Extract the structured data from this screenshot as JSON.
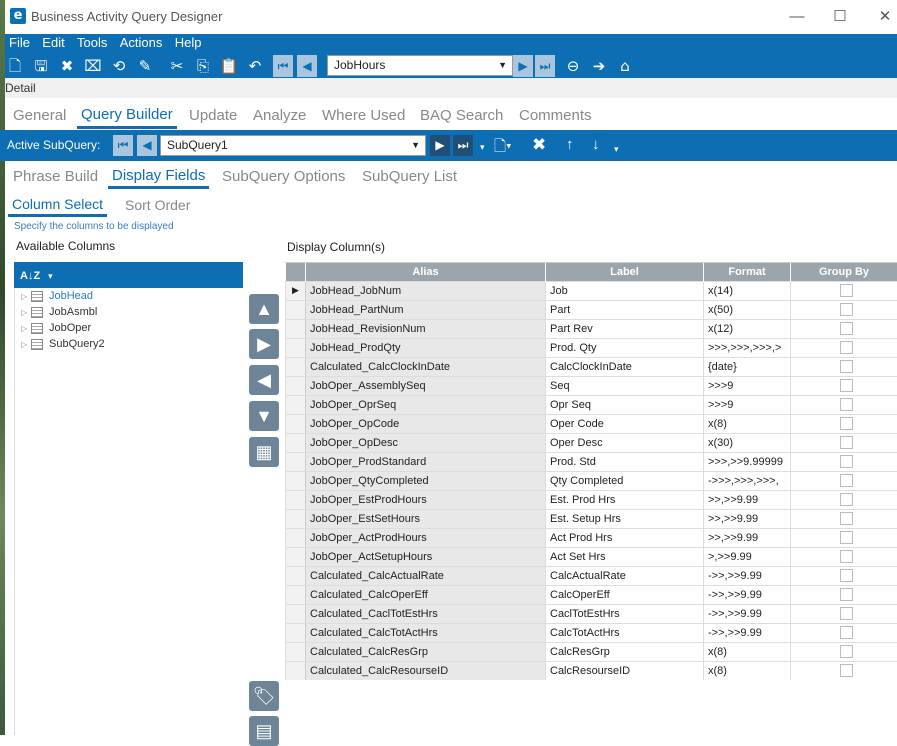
{
  "app": {
    "title": "Business Activity Query Designer",
    "logo_letter": "e",
    "min_glyph": "—",
    "max_glyph": "☐",
    "close_glyph": "✕"
  },
  "menu": [
    "File",
    "Edit",
    "Tools",
    "Actions",
    "Help"
  ],
  "toolbar": {
    "query_value": "JobHours",
    "icons": [
      "new-icon",
      "save-icon",
      "delete-icon",
      "clear-icon",
      "refresh-icon",
      "brush-icon",
      "cut-icon",
      "copy-icon",
      "paste-icon",
      "undo-icon",
      "first-icon",
      "prev-icon",
      "next-icon",
      "last-icon",
      "back-icon",
      "forward-icon",
      "home-icon"
    ]
  },
  "detail_label": "Detail",
  "main_tabs": [
    "General",
    "Query Builder",
    "Update",
    "Analyze",
    "Where Used",
    "BAQ Search",
    "Comments"
  ],
  "active_main_tab": "Query Builder",
  "subquery": {
    "label": "Active SubQuery:",
    "value": "SubQuery1"
  },
  "sub_tabs": [
    "Phrase Build",
    "Display Fields",
    "SubQuery Options",
    "SubQuery List"
  ],
  "active_sub_tab": "Display Fields",
  "inner_tabs": [
    "Column Select",
    "Sort Order"
  ],
  "active_inner_tab": "Column Select",
  "hint": "Specify the columns to be displayed",
  "available_columns_label": "Available Columns",
  "display_columns_label": "Display Column(s)",
  "tree_header_glyph": "A↓Z",
  "tree_items": [
    "JobHead",
    "JobAsmbl",
    "JobOper",
    "SubQuery2"
  ],
  "grid": {
    "headers": [
      "Alias",
      "Label",
      "Format",
      "Group By"
    ],
    "rows": [
      {
        "alias": "JobHead_JobNum",
        "label": "Job",
        "format": "x(14)"
      },
      {
        "alias": "JobHead_PartNum",
        "label": "Part",
        "format": "x(50)"
      },
      {
        "alias": "JobHead_RevisionNum",
        "label": "Part Rev",
        "format": "x(12)"
      },
      {
        "alias": "JobHead_ProdQty",
        "label": "Prod. Qty",
        "format": ">>>,>>>,>>>,>"
      },
      {
        "alias": "Calculated_CalcClockInDate",
        "label": "CalcClockInDate",
        "format": "{date}"
      },
      {
        "alias": "JobOper_AssemblySeq",
        "label": "Seq",
        "format": ">>>9"
      },
      {
        "alias": "JobOper_OprSeq",
        "label": "Opr Seq",
        "format": ">>>9"
      },
      {
        "alias": "JobOper_OpCode",
        "label": "Oper Code",
        "format": "x(8)"
      },
      {
        "alias": "JobOper_OpDesc",
        "label": "Oper Desc",
        "format": "x(30)"
      },
      {
        "alias": "JobOper_ProdStandard",
        "label": "Prod. Std",
        "format": ">>>,>>9.99999"
      },
      {
        "alias": "JobOper_QtyCompleted",
        "label": "Qty Completed",
        "format": "->>>,>>>,>>>,"
      },
      {
        "alias": "JobOper_EstProdHours",
        "label": "Est. Prod Hrs",
        "format": ">>,>>9.99"
      },
      {
        "alias": "JobOper_EstSetHours",
        "label": "Est. Setup Hrs",
        "format": ">>,>>9.99"
      },
      {
        "alias": "JobOper_ActProdHours",
        "label": "Act Prod Hrs",
        "format": ">>,>>9.99"
      },
      {
        "alias": "JobOper_ActSetupHours",
        "label": "Act Set Hrs",
        "format": ">,>>9.99"
      },
      {
        "alias": "Calculated_CalcActualRate",
        "label": "CalcActualRate",
        "format": "->>,>>9.99"
      },
      {
        "alias": "Calculated_CalcOperEff",
        "label": "CalcOperEff",
        "format": "->>,>>9.99"
      },
      {
        "alias": "Calculated_CaclTotEstHrs",
        "label": "CaclTotEstHrs",
        "format": "->>,>>9.99"
      },
      {
        "alias": "Calculated_CalcTotActHrs",
        "label": "CalcTotActHrs",
        "format": "->>,>>9.99"
      },
      {
        "alias": "Calculated_CalcResGrp",
        "label": "CalcResGrp",
        "format": "x(8)"
      },
      {
        "alias": "Calculated_CalcResourseID",
        "label": "CalcResourseID",
        "format": "x(8)"
      }
    ]
  },
  "side_buttons": [
    "move-up-icon",
    "add-column-icon",
    "remove-column-icon",
    "move-down-icon",
    "calculator-icon",
    "tag-icon",
    "table-icon"
  ],
  "colors": {
    "accent": "#0e6eb3",
    "header_gray": "#9aa5ad",
    "button_gray": "#6d8597"
  }
}
